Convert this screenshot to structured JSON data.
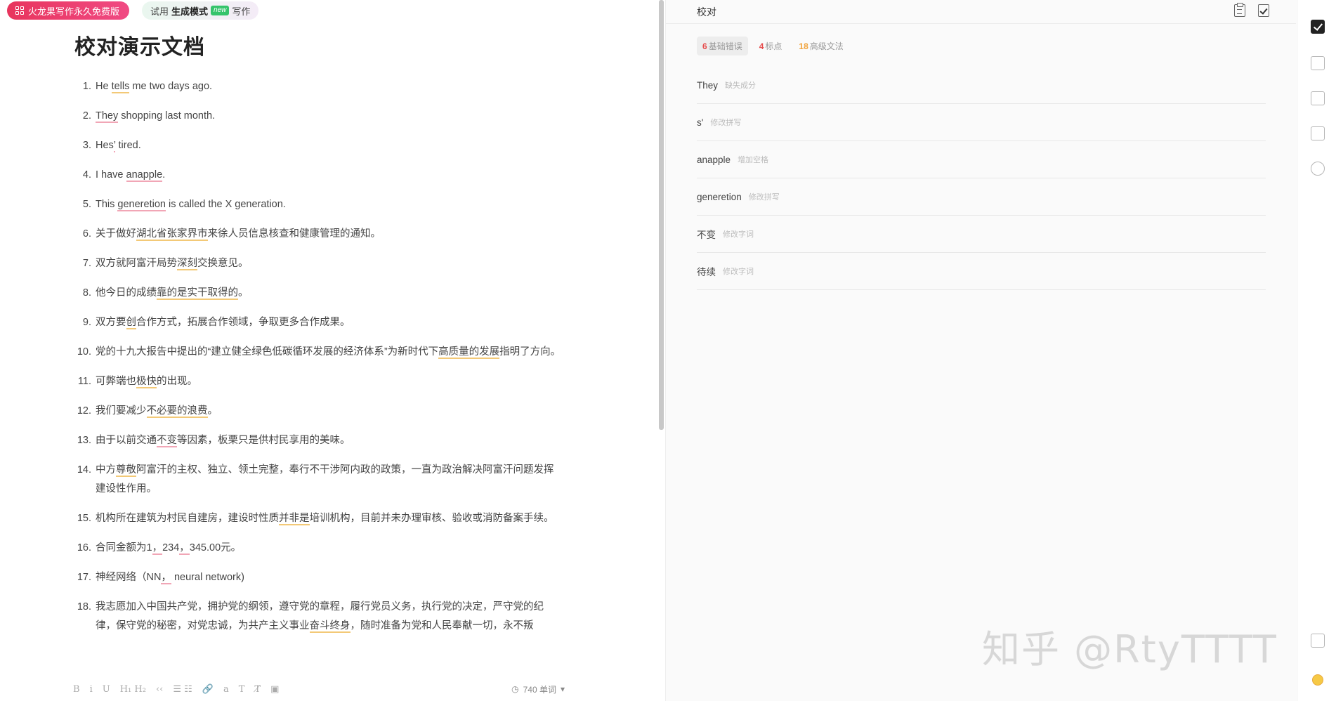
{
  "header": {
    "promo_label": "火龙果写作永久免费版",
    "trial_prefix": "试用",
    "trial_mode": "生成模式",
    "trial_new": "new",
    "trial_suffix": "写作"
  },
  "doc": {
    "title": "校对演示文档",
    "items": [
      {
        "num": "1.",
        "parts": [
          [
            "He ",
            ""
          ],
          [
            "tells",
            "y"
          ],
          [
            " me two days ago.",
            ""
          ]
        ]
      },
      {
        "num": "2.",
        "parts": [
          [
            "They",
            "r"
          ],
          [
            " shopping last month.",
            ""
          ]
        ]
      },
      {
        "num": "3.",
        "parts": [
          [
            "Hes",
            ""
          ],
          [
            "’",
            "r"
          ],
          [
            " tired.",
            ""
          ]
        ]
      },
      {
        "num": "4.",
        "parts": [
          [
            "I have ",
            ""
          ],
          [
            "anapple",
            "r"
          ],
          [
            ".",
            ""
          ]
        ]
      },
      {
        "num": "5.",
        "parts": [
          [
            "This ",
            ""
          ],
          [
            "generetion",
            "r"
          ],
          [
            " is called the X generation.",
            ""
          ]
        ]
      },
      {
        "num": "6.",
        "parts": [
          [
            "关于做好",
            ""
          ],
          [
            "湖北省张家界市",
            "y"
          ],
          [
            "来徐人员信息核查和健康管理的通知。",
            ""
          ]
        ]
      },
      {
        "num": "7.",
        "parts": [
          [
            "双方就阿富汗局势",
            ""
          ],
          [
            "深刻",
            "y"
          ],
          [
            "交换意见。",
            ""
          ]
        ]
      },
      {
        "num": "8.",
        "parts": [
          [
            "他今日的成绩",
            ""
          ],
          [
            "靠的是实干取得的",
            "y"
          ],
          [
            "。",
            ""
          ]
        ]
      },
      {
        "num": "9.",
        "parts": [
          [
            "双方要",
            ""
          ],
          [
            "创",
            "y"
          ],
          [
            "合作方式，拓展合作领域，争取更多合作成果。",
            ""
          ]
        ]
      },
      {
        "num": "10.",
        "parts": [
          [
            "党的十九大报告中提出的“建立健全绿色低碳循环发展的经济体系”为新时代下",
            ""
          ],
          [
            "高质量的发展",
            "y"
          ],
          [
            "指明了方向。",
            ""
          ]
        ]
      },
      {
        "num": "11.",
        "parts": [
          [
            "可弊端也",
            ""
          ],
          [
            "极快",
            "y"
          ],
          [
            "的出现。",
            ""
          ]
        ]
      },
      {
        "num": "12.",
        "parts": [
          [
            "我们要减少",
            ""
          ],
          [
            "不必要的浪费",
            "y"
          ],
          [
            "。",
            ""
          ]
        ]
      },
      {
        "num": "13.",
        "parts": [
          [
            "由于以前交通",
            ""
          ],
          [
            "不变",
            "r"
          ],
          [
            "等因素，板栗只是供村民享用的美味。",
            ""
          ]
        ]
      },
      {
        "num": "14.",
        "parts": [
          [
            "中方",
            ""
          ],
          [
            "尊敬",
            "y"
          ],
          [
            "阿富汗的主权、独立、领土完整，奉行不干涉阿内政的政策，一直为政治解决阿富汗问题发挥建设性作用。",
            ""
          ]
        ]
      },
      {
        "num": "15.",
        "parts": [
          [
            "机构所在建筑为村民自建房，建设时性质",
            ""
          ],
          [
            "并非是",
            "y"
          ],
          [
            "培训机构，目前并未办理审核、验收或消防备案手续。",
            ""
          ]
        ]
      },
      {
        "num": "16.",
        "parts": [
          [
            "合同金额为1",
            ""
          ],
          [
            "，",
            "r"
          ],
          [
            "234",
            ""
          ],
          [
            "，",
            "r"
          ],
          [
            "345.00元。",
            ""
          ]
        ]
      },
      {
        "num": "17.",
        "parts": [
          [
            "神经网络（NN",
            ""
          ],
          [
            "，",
            "r"
          ],
          [
            " neural network)",
            ""
          ]
        ]
      },
      {
        "num": "18.",
        "parts": [
          [
            "我志愿加入中国共产党，拥护党的纲领，遵守党的章程，履行党员义务，执行党的决定，严守党的纪律，保守党的秘密，对党忠诚，为共产主义事业",
            ""
          ],
          [
            "奋斗终身",
            "y"
          ],
          [
            "，随时准备为党和人民奉献一切，永不叛",
            ""
          ]
        ]
      }
    ]
  },
  "toolbar": {
    "buttons": [
      "B",
      "i",
      "U",
      "H₁ H₂",
      "‹‹",
      "☰ ☷",
      "🔗",
      "a",
      "T",
      "T̸",
      "▣"
    ],
    "word_count": "740 单词",
    "clock_icon": "clock-icon"
  },
  "proof": {
    "title": "校对",
    "tabs": [
      {
        "count": "6",
        "label": "基础错误",
        "color": "#e64b4b"
      },
      {
        "count": "4",
        "label": "标点",
        "color": "#e64b4b"
      },
      {
        "count": "18",
        "label": "高级文法",
        "color": "#f0a33c"
      }
    ],
    "issues": [
      {
        "word": "They",
        "tag": "缺失成分"
      },
      {
        "word": "s'",
        "tag": "修改拼写"
      },
      {
        "word": "anapple",
        "tag": "增加空格"
      },
      {
        "word": "generetion",
        "tag": "修改拼写"
      },
      {
        "word": "不变",
        "tag": "修改字词"
      },
      {
        "word": "待续",
        "tag": "修改字词"
      }
    ],
    "watermark": "知乎 @RtyTTTT"
  },
  "sidebar": {
    "icons": [
      "proofread-icon",
      "translate-icon",
      "rewrite-icon",
      "favorite-icon",
      "compass-icon",
      "expand-icon",
      "emoji-icon"
    ]
  }
}
